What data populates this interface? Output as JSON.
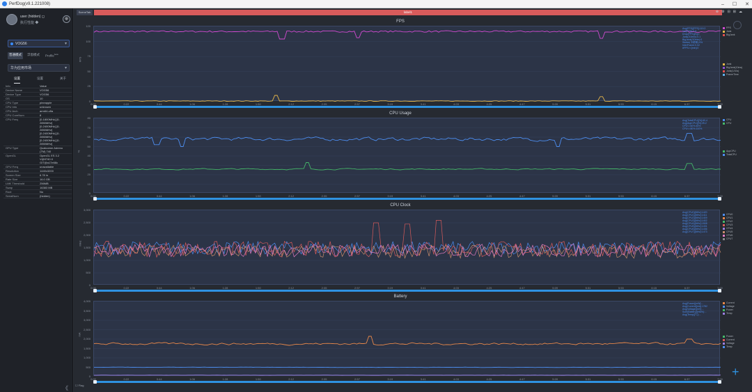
{
  "window": {
    "title": "PerfDog(v9.1.221008)",
    "buttons": [
      "–",
      "☐",
      "✕"
    ]
  },
  "sidebar": {
    "user_name": "user (hidden) ◻",
    "user_sub": "执行性能 ◆",
    "user_button": "⊕",
    "device": "VOG56",
    "mode_tabs": [
      "普通模式",
      "浮窗模式",
      "Profile"
    ],
    "mode_tab_badge": "beta",
    "app": "华为应用市场",
    "sub_tabs": [
      "设置",
      "设置",
      "关于"
    ],
    "info": [
      {
        "k": "Info",
        "v": "Value"
      },
      {
        "k": "Device Name",
        "v": "VOG56"
      },
      {
        "k": "Device Type",
        "v": "VOG56"
      },
      {
        "k": "OS",
        "v": "10"
      },
      {
        "k": "CPU Type",
        "v": "pineapple"
      },
      {
        "k": "CPU Info",
        "v": "unknown"
      },
      {
        "k": "CPU Arch",
        "v": "arm64-v8a"
      },
      {
        "k": "CPU CoreNum",
        "v": "8"
      },
      {
        "k": "CPU Freq",
        "v": "[0-1800MHz] [0-2850MHz]\n[0-2400MHz] [0-2850MHz]\n[0-2400MHz] [0-2850MHz]\n[0-2400MHz] [0-2850MHz]"
      },
      {
        "k": "GPU Type",
        "v": "Qualcomm Adreno\n(TM) 740"
      },
      {
        "k": "OpenGL",
        "v": "OpenGL ES 3.2\nV@0740.0\nGIT@a17e68c"
      },
      {
        "k": "GPU Freq",
        "v": "unavailable"
      },
      {
        "k": "Resolution",
        "v": "1440x3200"
      },
      {
        "k": "Screen Size",
        "v": "6.78 in"
      },
      {
        "k": "Rate Size",
        "v": "16.0 GB"
      },
      {
        "k": "LMK Threshold",
        "v": "256MB"
      },
      {
        "k": "Swap",
        "v": "16383 MB"
      },
      {
        "k": "Root",
        "v": "No"
      },
      {
        "k": "SerialNum",
        "v": "(hidden)"
      }
    ],
    "collapse_label": "《"
  },
  "main": {
    "top_tab": "SceneTab",
    "label_bar": "label1",
    "tools": [
      "⊕",
      "⚙",
      "⊟",
      "⊞",
      "☁"
    ],
    "bottom_flag": "☐ Flag"
  },
  "colors": {
    "accent": "#2f92e0",
    "label_bar": "#d85b5b"
  },
  "x_ticks": [
    "0:00",
    "0:22",
    "0:44",
    "1:06",
    "1:28",
    "1:50",
    "2:12",
    "2:35",
    "2:57",
    "3:19",
    "3:41",
    "4:03",
    "4:25",
    "4:47",
    "5:09",
    "5:31",
    "5:53",
    "6:15",
    "6:37",
    "7:00"
  ],
  "chart_data": [
    {
      "type": "line",
      "title": "FPS",
      "ylabel": "FPS",
      "yticks": [
        "120",
        "100",
        "75",
        "50",
        "25",
        "0"
      ],
      "ylim": [
        0,
        120
      ],
      "legend_right": [
        {
          "name": "FPS",
          "color": "#d24bd2"
        },
        {
          "name": "Jank",
          "color": "#e8b84a"
        },
        {
          "name": "BigJank",
          "color": "#e05050"
        }
      ],
      "legend_low": [
        {
          "name": "Jank",
          "color": "#e8b84a"
        },
        {
          "name": "BigJank(10ms)",
          "color": "#9050d0"
        },
        {
          "name": "Jank(1/10s)",
          "color": "#e05050"
        },
        {
          "name": "FrameTime",
          "color": "#5fb0e8"
        }
      ],
      "series": [
        {
          "name": "FPS",
          "base": 112,
          "noise": 1.2,
          "spikes": [
            [
              0.3,
              100
            ],
            [
              0.42,
              102
            ],
            [
              0.81,
              101
            ]
          ]
        },
        {
          "name": "Jank",
          "base": 1,
          "noise": 0.5,
          "spikes": [
            [
              0.29,
              10
            ],
            [
              0.81,
              8
            ]
          ]
        }
      ]
    },
    {
      "type": "line",
      "title": "CPU Usage",
      "ylabel": "%",
      "yticks": [
        "80",
        "70",
        "60",
        "50",
        "40",
        "30",
        "20",
        "10",
        "0"
      ],
      "ylim": [
        0,
        80
      ],
      "legend_right": [
        {
          "name": "CPU",
          "color": "#4d8ef0"
        },
        {
          "name": "CPU",
          "color": "#45b86a"
        }
      ],
      "legend_low": [
        {
          "name": "AppCPU",
          "color": "#45b86a"
        },
        {
          "name": "TotalCPU",
          "color": "#4d8ef0"
        }
      ],
      "series": [
        {
          "name": "TotalCPU",
          "base": 58,
          "noise": 3.5,
          "spikes": [
            [
              0.1,
              52
            ],
            [
              0.14,
              50
            ],
            [
              0.74,
              50
            ],
            [
              0.95,
              64
            ]
          ]
        },
        {
          "name": "AppCPU",
          "base": 26,
          "noise": 1.2,
          "spikes": [
            [
              0.34,
              33
            ],
            [
              0.95,
              32
            ]
          ]
        }
      ]
    },
    {
      "type": "line",
      "title": "CPU Clock",
      "ylabel": "MHz",
      "yticks": [
        "3,000",
        "2,500",
        "2,000",
        "1,500",
        "1,000",
        "500",
        "0"
      ],
      "ylim": [
        0,
        3000
      ],
      "legend_right": [
        {
          "name": "CPU0",
          "color": "#4d8ef0"
        },
        {
          "name": "CPU1",
          "color": "#e8884a"
        },
        {
          "name": "CPU2",
          "color": "#45b86a"
        },
        {
          "name": "CPU3",
          "color": "#d85b5b"
        },
        {
          "name": "CPU4",
          "color": "#9a7ee0"
        },
        {
          "name": "CPU5",
          "color": "#c98c6a"
        },
        {
          "name": "CPU6",
          "color": "#e07ac0"
        },
        {
          "name": "CPU7",
          "color": "#8a8a8a"
        }
      ],
      "series": [
        {
          "name": "CPU0",
          "base": 1500,
          "noise": 260,
          "spikes": []
        },
        {
          "name": "CPU3",
          "base": 1450,
          "noise": 320,
          "spikes": [
            [
              0.45,
              2500
            ],
            [
              0.5,
              2450
            ],
            [
              0.55,
              2600
            ]
          ]
        },
        {
          "name": "CPU5",
          "base": 1350,
          "noise": 260,
          "spikes": []
        },
        {
          "name": "CPU6",
          "base": 1400,
          "noise": 260,
          "spikes": []
        }
      ]
    },
    {
      "type": "line",
      "title": "Battery",
      "ylabel": "mA",
      "yticks": [
        "4,000",
        "3,500",
        "3,000",
        "2,500",
        "2,000",
        "1,500",
        "1,000",
        "500",
        "0"
      ],
      "ylim": [
        0,
        4000
      ],
      "legend_right": [
        {
          "name": "Current",
          "color": "#e8884a"
        },
        {
          "name": "Voltage",
          "color": "#4d8ef0"
        },
        {
          "name": "Power",
          "color": "#45b86a"
        },
        {
          "name": "Temp",
          "color": "#9a7ee0"
        }
      ],
      "legend_low": [
        {
          "name": "Power",
          "color": "#45b86a"
        },
        {
          "name": "Current",
          "color": "#d85b5b"
        },
        {
          "name": "Voltage",
          "color": "#9a7ee0"
        },
        {
          "name": "Temp",
          "color": "#4d8ef0"
        }
      ],
      "series": [
        {
          "name": "Current",
          "base": 1750,
          "noise": 110,
          "spikes": [
            [
              0.44,
              2150
            ],
            [
              0.95,
              2000
            ]
          ]
        },
        {
          "name": "Voltage",
          "base": 500,
          "noise": 20,
          "spikes": []
        },
        {
          "name": "Temp",
          "base": 80,
          "noise": 8,
          "spikes": []
        }
      ]
    }
  ],
  "stats_boxes": [
    [
      "Avg(FPS)[FPS]:119.2",
      "Var(FPS):0.9",
      "Drop(FPS)[/h]:0",
      "Jank(/10min):0.1",
      "BigJank(/10min):0",
      "Stutter(卡顿率):0%",
      "InterFrame:0.02",
      "#FPS>=[min]:0"
    ],
    [
      "Avg(TotalCPU)[%]:60.4",
      "Avg(AppCPU)[%]:25.2",
      "CPU<=60%:45%",
      "CPU<=80%:100%"
    ],
    [
      "Avg(CPU0)[MHz]:1420",
      "Avg(CPU1)[MHz]:1411",
      "Avg(CPU2)[MHz]:1409",
      "Avg(CPU3)[MHz]:1402",
      "Avg(CPU4)[MHz]:1508",
      "Avg(CPU5)[MHz]:1431",
      "Avg(CPU6)[MHz]:1436",
      "Avg(CPU7)[MHz]:1473"
    ],
    [
      "Avg(Power)[mW]:...",
      "Avg(Current)[mA]:1782",
      "Avg(Voltage)[mV]:...",
      "Sum(Battery)[mWh]:...",
      "Avg(Temp)[°C]:..."
    ]
  ]
}
